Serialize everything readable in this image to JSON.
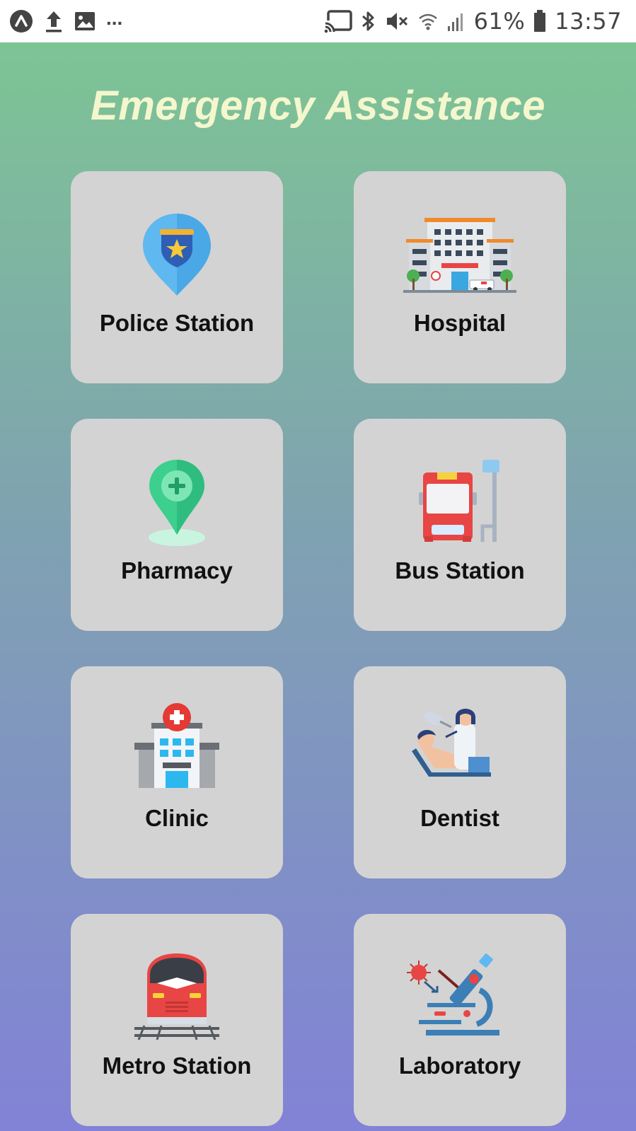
{
  "status_bar": {
    "left_icons": [
      "app-notification-icon",
      "upload-icon",
      "image-icon"
    ],
    "more": "...",
    "right_icons": [
      "cast-icon",
      "bluetooth-icon",
      "vibrate-icon",
      "wifi-icon",
      "signal-icon"
    ],
    "battery": "61%",
    "time": "13:57"
  },
  "app": {
    "title": "Emergency Assistance",
    "colors": {
      "gradient_top": "#7dc495",
      "gradient_bottom": "#8282d6",
      "title": "#f4f7cd",
      "card": "#d3d3d3"
    },
    "cards": [
      {
        "label": "Police Station",
        "icon": "police-badge-pin-icon"
      },
      {
        "label": "Hospital",
        "icon": "hospital-building-icon"
      },
      {
        "label": "Pharmacy",
        "icon": "pharmacy-pin-icon"
      },
      {
        "label": "Bus Station",
        "icon": "bus-stop-icon"
      },
      {
        "label": "Clinic",
        "icon": "clinic-building-icon"
      },
      {
        "label": "Dentist",
        "icon": "dentist-icon"
      },
      {
        "label": "Metro Station",
        "icon": "metro-train-icon"
      },
      {
        "label": "Laboratory",
        "icon": "microscope-icon"
      }
    ]
  }
}
